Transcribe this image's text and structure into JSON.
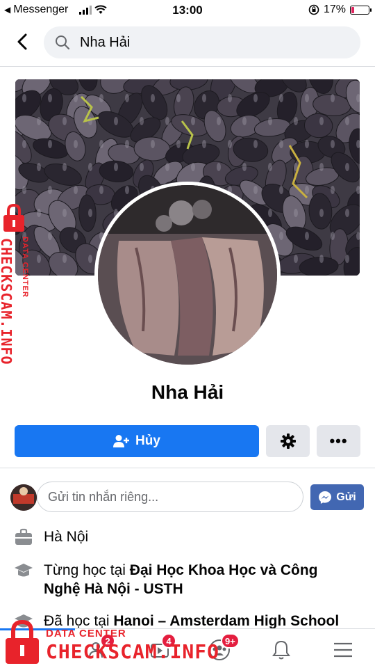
{
  "status_bar": {
    "back_app": "Messenger",
    "time": "13:00",
    "battery_percent": "17%",
    "battery_level": 0.17
  },
  "search": {
    "query": "Nha Hải"
  },
  "profile": {
    "name": "Nha Hải"
  },
  "actions": {
    "primary_label": "Hủy"
  },
  "message": {
    "placeholder": "Gửi tin nhắn riêng...",
    "send_label": "Gửi"
  },
  "info": [
    {
      "prefix": "",
      "bold": "Hà Nội",
      "icon": "briefcase-icon"
    },
    {
      "prefix": "Từng học tại ",
      "bold": "Đại Học Khoa Học và Công Nghệ Hà Nội - USTH",
      "icon": "graduation-cap-icon"
    },
    {
      "prefix": "Đã học tại ",
      "bold": "Hanoi – Amsterdam High School",
      "icon": "graduation-cap-icon"
    }
  ],
  "bottom_nav": {
    "badges": [
      "2",
      "4",
      "9+"
    ]
  },
  "watermark": {
    "main": "CHECKSCAM.INFO",
    "sub": "DATA CENTER"
  },
  "colors": {
    "primary": "#1877f2",
    "messenger_button": "#4267b2",
    "badge": "#e41e3f",
    "watermark": "#e8232b"
  }
}
